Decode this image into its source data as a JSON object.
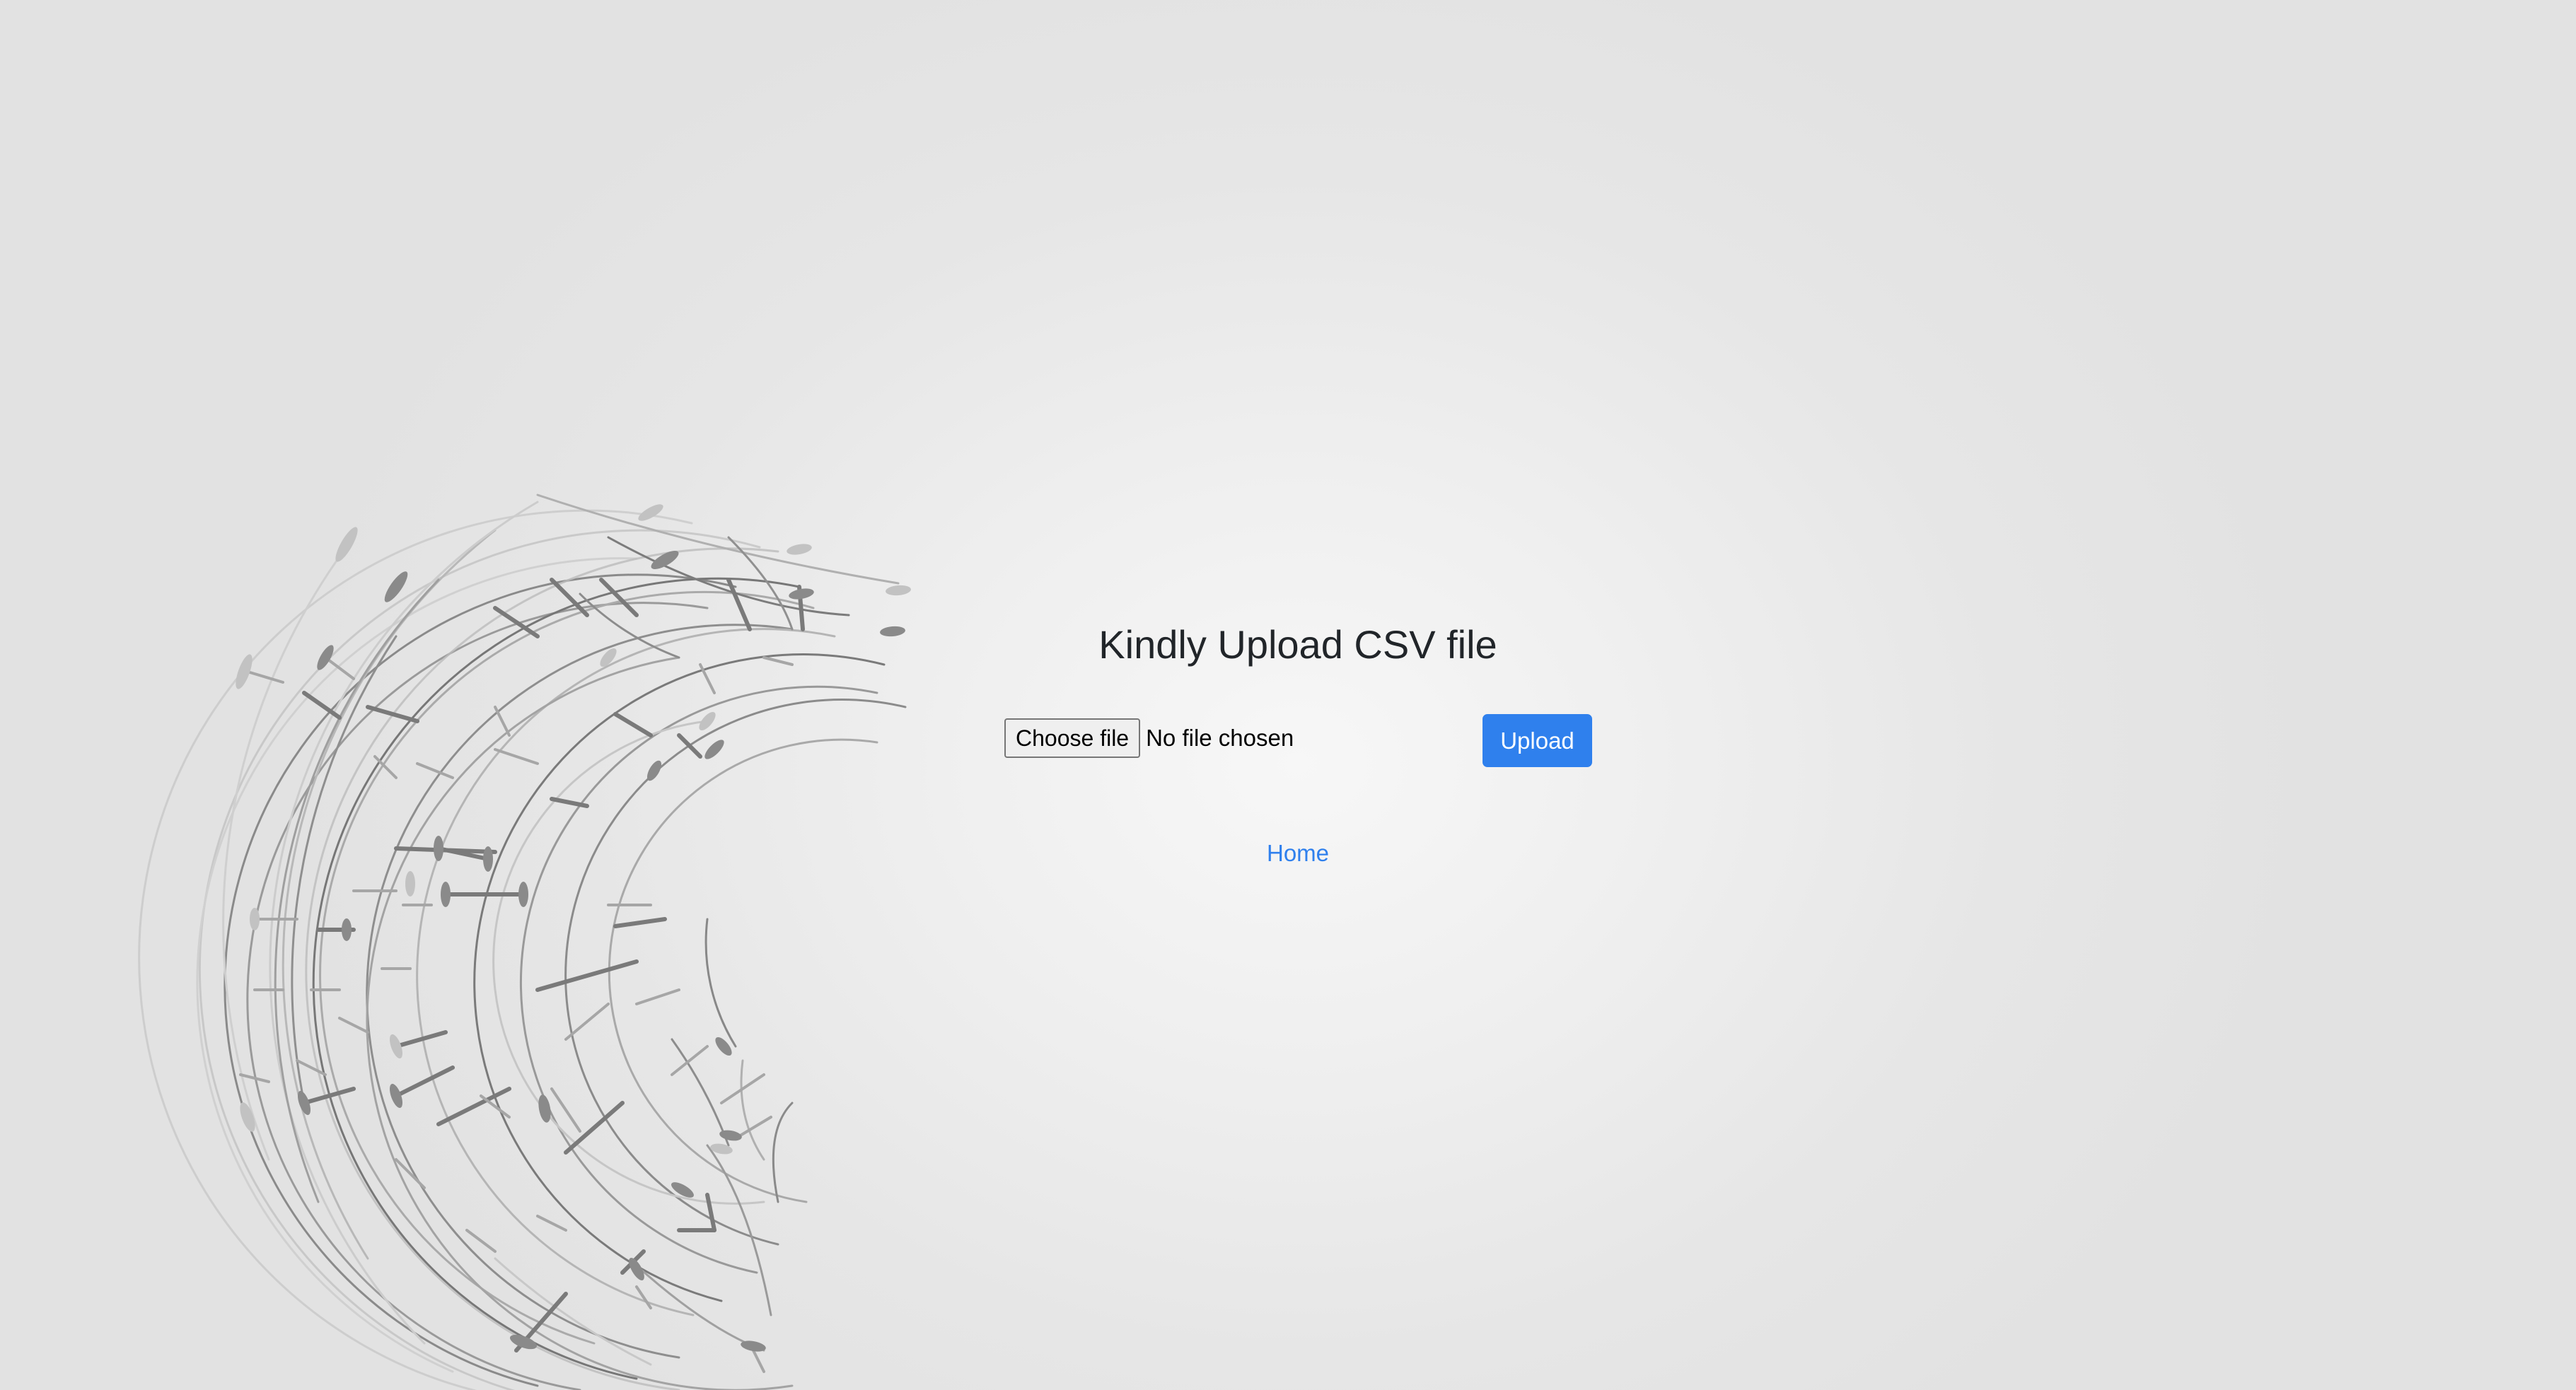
{
  "page": {
    "title": "Kindly Upload CSV file"
  },
  "upload_form": {
    "choose_file_label": "Choose file",
    "file_status": "No file chosen",
    "upload_label": "Upload"
  },
  "nav": {
    "home_label": "Home"
  },
  "colors": {
    "accent": "#2f80ed",
    "title_text": "#212529",
    "background": "#e6e6e6",
    "art_stroke": "#7a7a7a"
  },
  "icons": {
    "background_art": "circuit-arc-decoration"
  }
}
